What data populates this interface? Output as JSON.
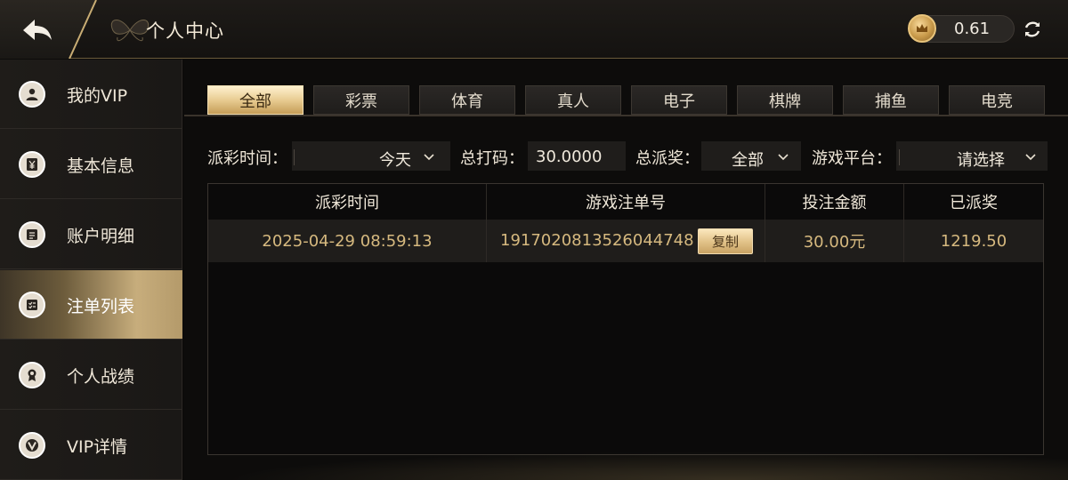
{
  "header": {
    "title": "个人中心",
    "balance": "0.61",
    "icons": {
      "back": "back-arrow-icon",
      "coin": "crown-coin-icon",
      "refresh": "refresh-icon"
    }
  },
  "sidebar": {
    "items": [
      {
        "label": "我的VIP",
        "icon": "user-icon",
        "active": false
      },
      {
        "label": "基本信息",
        "icon": "yuan-card-icon",
        "active": false
      },
      {
        "label": "账户明细",
        "icon": "ledger-icon",
        "active": false
      },
      {
        "label": "注单列表",
        "icon": "bet-list-icon",
        "active": true
      },
      {
        "label": "个人战绩",
        "icon": "medal-icon",
        "active": false
      },
      {
        "label": "VIP详情",
        "icon": "vip-badge-icon",
        "active": false
      }
    ]
  },
  "tabs": [
    {
      "label": "全部",
      "active": true
    },
    {
      "label": "彩票",
      "active": false
    },
    {
      "label": "体育",
      "active": false
    },
    {
      "label": "真人",
      "active": false
    },
    {
      "label": "电子",
      "active": false
    },
    {
      "label": "棋牌",
      "active": false
    },
    {
      "label": "捕鱼",
      "active": false
    },
    {
      "label": "电竞",
      "active": false
    }
  ],
  "filters": {
    "payout_time": {
      "label": "派彩时间：",
      "value": "今天"
    },
    "total_turnover": {
      "label": "总打码：",
      "value": "30.0000"
    },
    "total_payout": {
      "label": "总派奖：",
      "value": "全部"
    },
    "game_platform": {
      "label": "游戏平台：",
      "value": "请选择"
    }
  },
  "table": {
    "columns": [
      "派彩时间",
      "游戏注单号",
      "投注金额",
      "已派奖"
    ],
    "rows": [
      {
        "payout_time": "2025-04-29 08:59:13",
        "order_no": "1917020813526044748",
        "copy_label": "复制",
        "bet_amount": "30.00元",
        "paid": "1219.50"
      }
    ]
  },
  "colors": {
    "gold": "#d6b97f",
    "active_tab": "#e8cc92",
    "background": "#0d0c0b"
  }
}
